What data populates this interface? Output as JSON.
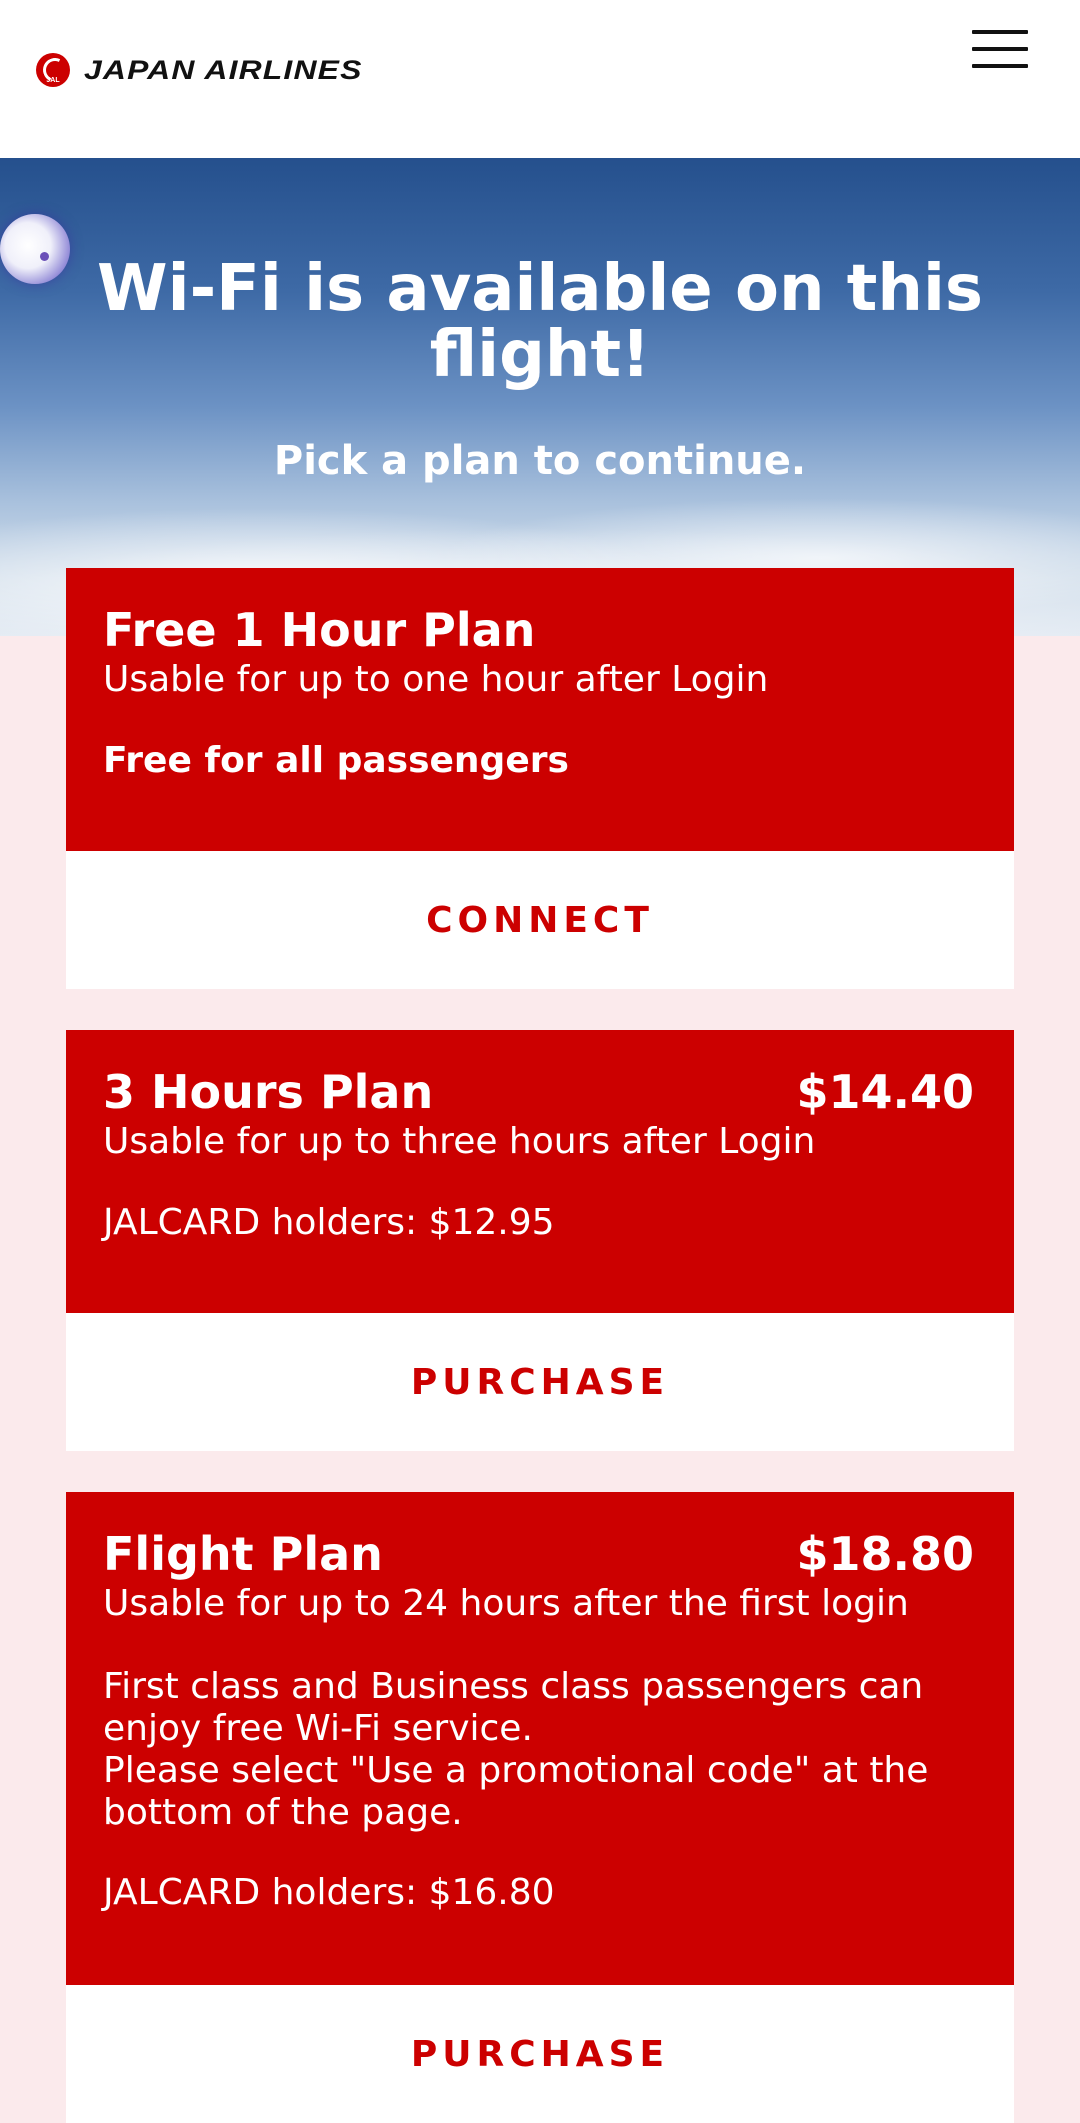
{
  "header": {
    "logo_mark_text": "JAL",
    "brand_name": "JAPAN AIRLINES"
  },
  "hero": {
    "title": "Wi-Fi is available on this flight!",
    "subtitle": "Pick a plan to continue."
  },
  "plans": [
    {
      "name": "Free 1 Hour Plan",
      "price": "",
      "description": "Usable for up to one hour after Login",
      "note": "Free for all passengers",
      "action": "CONNECT"
    },
    {
      "name": "3 Hours Plan",
      "price": "$14.40",
      "description": "Usable for up to three hours after Login",
      "note": "JALCARD holders: $12.95",
      "action": "PURCHASE"
    },
    {
      "name": "Flight Plan",
      "price": "$18.80",
      "description": "Usable for up to 24 hours after the first login",
      "extra_line_1": "First class and Business class passengers can enjoy free Wi-Fi service.",
      "extra_line_2": "Please select \"Use a promotional code\" at the bottom of the page.",
      "note": "JALCARD holders: $16.80",
      "action": "PURCHASE"
    }
  ],
  "colors": {
    "brand_red": "#cc0000",
    "page_background": "#fbeaec",
    "hero_sky_top": "#25508d"
  },
  "icons": {
    "menu": "hamburger-icon",
    "logo": "jal-crane-logo",
    "floating": "assistant-bubble-icon"
  }
}
